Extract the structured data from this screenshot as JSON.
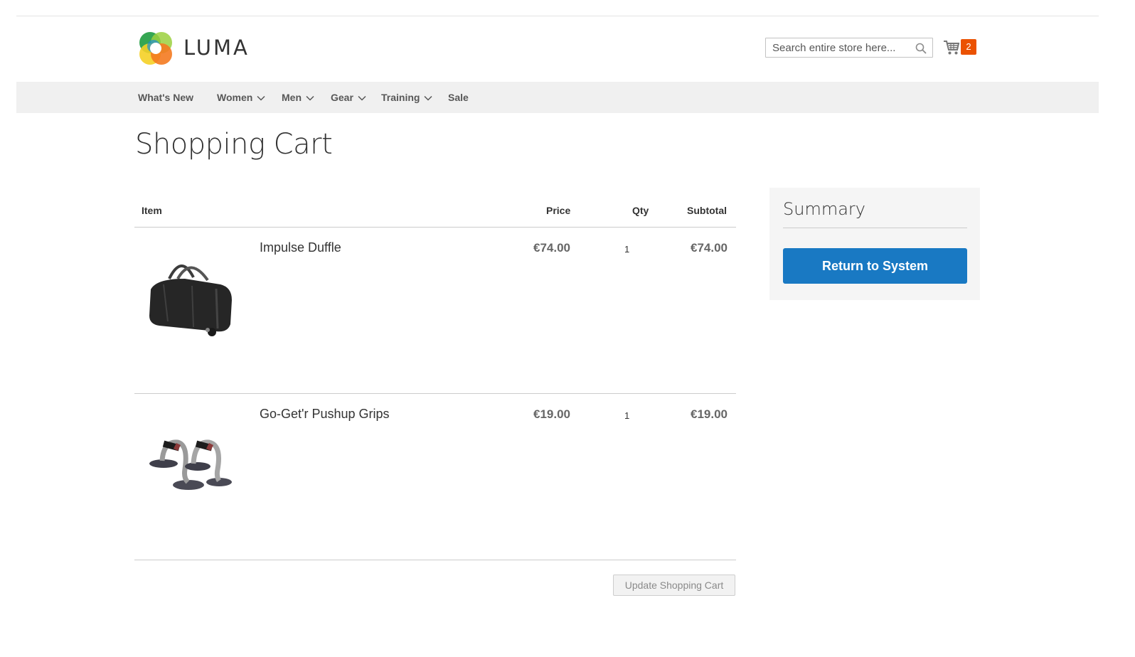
{
  "header": {
    "logo_text": "LUMA",
    "search": {
      "placeholder": "Search entire store here...",
      "value": ""
    },
    "cart": {
      "count": "2"
    }
  },
  "nav": {
    "items": [
      {
        "label": "What's New",
        "has_dropdown": false
      },
      {
        "label": "Women",
        "has_dropdown": true
      },
      {
        "label": "Men",
        "has_dropdown": true
      },
      {
        "label": "Gear",
        "has_dropdown": true
      },
      {
        "label": "Training",
        "has_dropdown": true
      },
      {
        "label": "Sale",
        "has_dropdown": false
      }
    ]
  },
  "page": {
    "title": "Shopping Cart"
  },
  "cart_table": {
    "headers": {
      "item": "Item",
      "price": "Price",
      "qty": "Qty",
      "subtotal": "Subtotal"
    },
    "rows": [
      {
        "name": "Impulse Duffle",
        "price": "€74.00",
        "qty": "1",
        "subtotal": "€74.00",
        "image_icon": "duffle-bag-icon"
      },
      {
        "name": "Go-Get'r Pushup Grips",
        "price": "€19.00",
        "qty": "1",
        "subtotal": "€19.00",
        "image_icon": "pushup-grips-icon"
      }
    ],
    "update_label": "Update Shopping Cart"
  },
  "summary": {
    "title": "Summary",
    "return_label": "Return to System"
  },
  "colors": {
    "primary_button": "#1979c3",
    "cart_badge": "#eb5202",
    "nav_background": "#f0f0f0",
    "summary_background": "#f5f5f5"
  }
}
